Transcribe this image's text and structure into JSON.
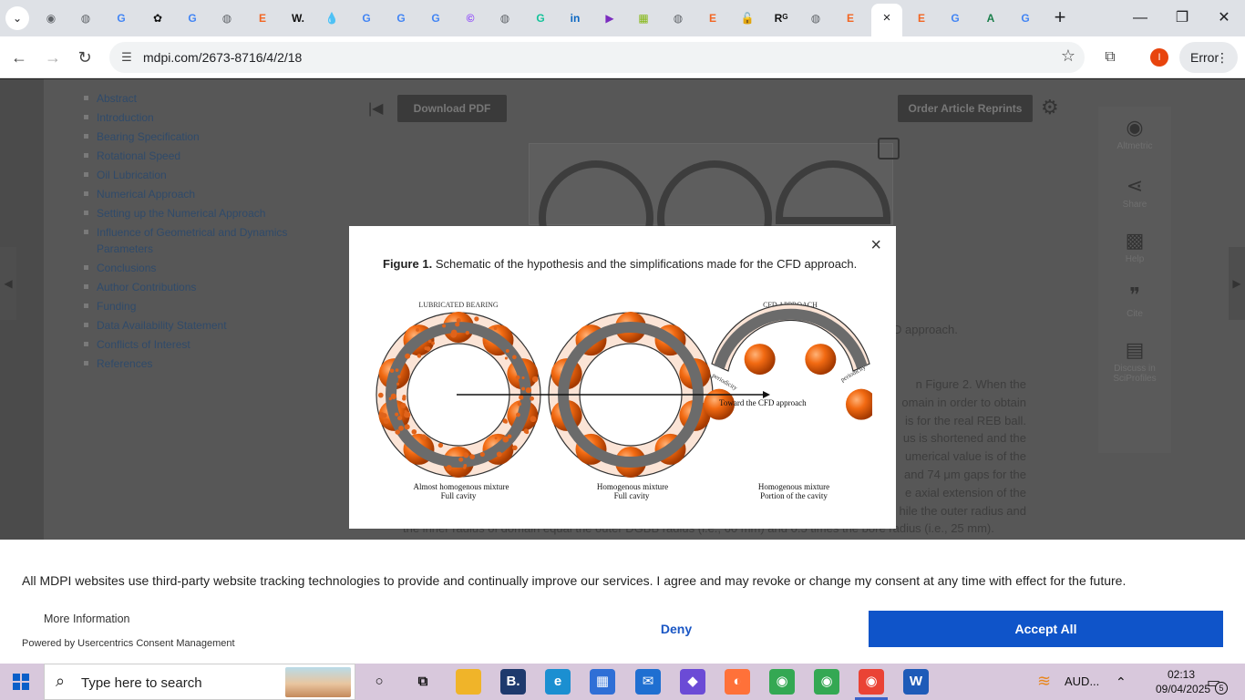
{
  "browser": {
    "active_tab_close": "×",
    "new_tab": "+",
    "url": "mdpi.com/2673-8716/4/2/18",
    "profile_initial": "I",
    "error_label": "Error",
    "menu_glyph": "⋮",
    "tabs": [
      {
        "icon": "chrome-icon",
        "glyph": "◉",
        "color": "#5f6368"
      },
      {
        "icon": "globe-icon",
        "glyph": "◍",
        "color": "#5f6368"
      },
      {
        "icon": "google-icon",
        "glyph": "G",
        "color": "#4285f4"
      },
      {
        "icon": "openai-icon",
        "glyph": "✿",
        "color": "#111111"
      },
      {
        "icon": "google-icon",
        "glyph": "G",
        "color": "#4285f4"
      },
      {
        "icon": "globe-icon",
        "glyph": "◍",
        "color": "#5f6368"
      },
      {
        "icon": "e-icon",
        "glyph": "E",
        "color": "#f26522"
      },
      {
        "icon": "wikipedia-icon",
        "glyph": "W.",
        "color": "#111111"
      },
      {
        "icon": "drop-icon",
        "glyph": "💧",
        "color": "#2b8cd6"
      },
      {
        "icon": "google-icon",
        "glyph": "G",
        "color": "#4285f4"
      },
      {
        "icon": "google-icon",
        "glyph": "G",
        "color": "#4285f4"
      },
      {
        "icon": "google-icon",
        "glyph": "G",
        "color": "#4285f4"
      },
      {
        "icon": "copilot-icon",
        "glyph": "©",
        "color": "#8a3ffc"
      },
      {
        "icon": "globe-icon",
        "glyph": "◍",
        "color": "#5f6368"
      },
      {
        "icon": "grammarly-icon",
        "glyph": "G",
        "color": "#15c39a"
      },
      {
        "icon": "linkedin-icon",
        "glyph": "in",
        "color": "#0a66c2"
      },
      {
        "icon": "play-icon",
        "glyph": "▶",
        "color": "#7b2cbf"
      },
      {
        "icon": "document-icon",
        "glyph": "▦",
        "color": "#86b817"
      },
      {
        "icon": "globe-icon",
        "glyph": "◍",
        "color": "#5f6368"
      },
      {
        "icon": "e-icon",
        "glyph": "E",
        "color": "#f26522"
      },
      {
        "icon": "lock-icon",
        "glyph": "🔓",
        "color": "#333333"
      },
      {
        "icon": "researchgate-icon",
        "glyph": "Rᴳ",
        "color": "#111111"
      },
      {
        "icon": "globe-icon",
        "glyph": "◍",
        "color": "#5f6368"
      },
      {
        "icon": "e-icon",
        "glyph": "E",
        "color": "#f26522"
      },
      {
        "icon": "e-icon",
        "glyph": "E",
        "color": "#f26522"
      },
      {
        "icon": "google-icon",
        "glyph": "G",
        "color": "#4285f4"
      },
      {
        "icon": "a-icon",
        "glyph": "A",
        "color": "#1a7f4b"
      },
      {
        "icon": "google-icon",
        "glyph": "G",
        "color": "#4285f4"
      }
    ]
  },
  "page": {
    "toc": [
      "Abstract",
      "Introduction",
      "Bearing Specification",
      "Rotational Speed",
      "Oil Lubrication",
      "Numerical Approach",
      "Setting up the Numerical Approach",
      "Influence of Geometrical and Dynamics Parameters",
      "Conclusions",
      "Author Contributions",
      "Funding",
      "Data Availability Statement",
      "Conflicts of Interest",
      "References"
    ],
    "download_pdf": "Download PDF",
    "order_reprints": "Order Article Reprints",
    "rail": [
      "Altmetric",
      "Share",
      "Help",
      "Cite",
      "Discuss in SciProfiles"
    ],
    "text_fragment_1": "D approach.",
    "text_lines": [
      "n Figure 2. When the",
      "omain in order to obtain",
      "is for the real REB ball.",
      "us is shortened and the",
      "umerical value is of the",
      "and 74 μm gaps for the",
      "e axial extension of the",
      "hile the outer radius and",
      "the inner radius of domain equal the outer DGBB radius (i.e., 60 mm) and 0.5 times the bore radius (i.e., 25 mm)."
    ]
  },
  "modal": {
    "close": "×",
    "figure_label": "Figure 1.",
    "caption": "Schematic of the hypothesis and the simplifications made for the CFD approach.",
    "figure": {
      "label_lubricated": "LUBRICATED BEARING",
      "label_cfd": "CFD APPROACH",
      "arrow_label": "Toward the CFD approach",
      "periodicity": "periodicity",
      "cap1_a": "Almost homogenous mixture",
      "cap1_b": "Full cavity",
      "cap2_a": "Homogenous mixture",
      "cap2_b": "Full cavity",
      "cap3_a": "Homogenous mixture",
      "cap3_b": "Portion of the cavity"
    }
  },
  "consent": {
    "message": "All MDPI websites use third-party website tracking technologies to provide and continually improve our services. I agree and may revoke or change my consent at any time with effect for the future.",
    "more_info": "More Information",
    "powered_by": "Powered by Usercentrics Consent Management",
    "deny": "Deny",
    "accept_all": "Accept All"
  },
  "taskbar": {
    "search_placeholder": "Type here to search",
    "audio_label": "AUD...",
    "time": "02:13",
    "date": "09/04/2025",
    "notification_count": "5",
    "apps": [
      {
        "icon": "cortana-icon",
        "glyph": "○",
        "color": "#00000000",
        "fg": "#111111"
      },
      {
        "icon": "task-view-icon",
        "glyph": "⧉",
        "color": "#00000000",
        "fg": "#111111"
      },
      {
        "icon": "file-explorer-icon",
        "glyph": "▬",
        "color": "#f0b429",
        "fg": "#f0b429"
      },
      {
        "icon": "b-app-icon",
        "glyph": "B.",
        "color": "#1e3a6d",
        "fg": "#ffffff"
      },
      {
        "icon": "edge-icon",
        "glyph": "e",
        "color": "#1b8fd1",
        "fg": "#ffffff"
      },
      {
        "icon": "store-icon",
        "glyph": "▦",
        "color": "#2f6fd6",
        "fg": "#ffffff"
      },
      {
        "icon": "mail-icon",
        "glyph": "✉",
        "color": "#1f6fd1",
        "fg": "#ffffff"
      },
      {
        "icon": "m365-icon",
        "glyph": "◆",
        "color": "#6b4bd6",
        "fg": "#ffffff"
      },
      {
        "icon": "firefox-icon",
        "glyph": "◐",
        "color": "#ff7139",
        "fg": "#ffffff"
      },
      {
        "icon": "chrome-icon",
        "glyph": "◉",
        "color": "#34a853",
        "fg": "#ffffff"
      },
      {
        "icon": "chrome-profile-icon",
        "glyph": "◉",
        "color": "#34a853",
        "fg": "#ffffff"
      },
      {
        "icon": "chrome-active-icon",
        "glyph": "◉",
        "color": "#ea4335",
        "fg": "#ffffff"
      },
      {
        "icon": "word-icon",
        "glyph": "W",
        "color": "#1e5bb8",
        "fg": "#ffffff"
      }
    ]
  }
}
